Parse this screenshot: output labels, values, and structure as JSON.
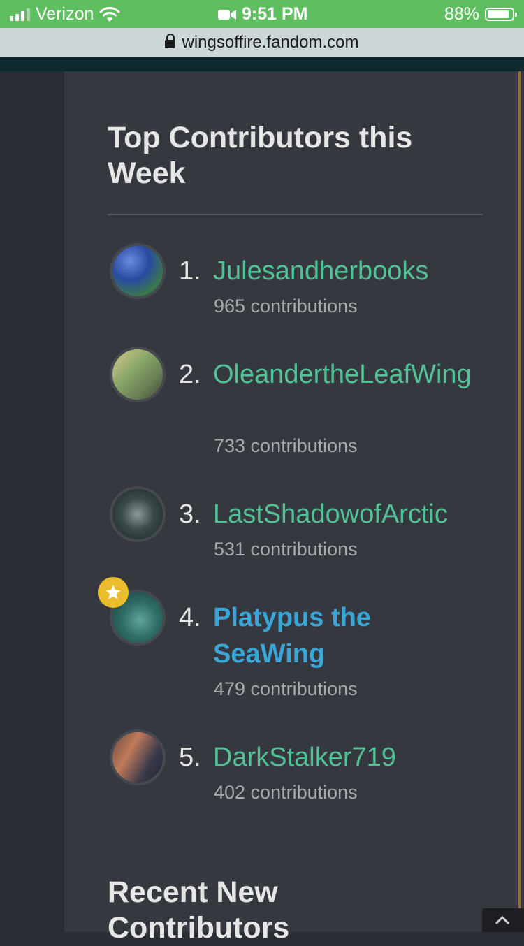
{
  "status_bar": {
    "carrier": "Verizon",
    "time": "9:51 PM",
    "battery": "88%",
    "battery_level": 0.88,
    "icons": [
      "signal-icon",
      "wifi-icon",
      "video-camera-icon",
      "battery-icon"
    ]
  },
  "url_bar": {
    "url": "wingsoffire.fandom.com",
    "icon": "lock-icon"
  },
  "section": {
    "title": "Top Contributors this Week"
  },
  "contributors": [
    {
      "rank": "1.",
      "name": "Julesandherbooks",
      "count": "965 contributions"
    },
    {
      "rank": "2.",
      "name": "OleandertheLeafWing",
      "count": "733 contributions"
    },
    {
      "rank": "3.",
      "name": "LastShadowofArctic",
      "count": "531 contributions"
    },
    {
      "rank": "4.",
      "name": "Platypus the SeaWing",
      "count": "479 contributions",
      "badge_icon": "star-icon"
    },
    {
      "rank": "5.",
      "name": "DarkStalker719",
      "count": "402 contributions"
    }
  ],
  "next_section": {
    "title": "Recent New Contributors"
  },
  "colors": {
    "status_bar": "#5fbe5f",
    "panel": "#35383e",
    "link": "#53c196",
    "highlight_link": "#3aa6d8",
    "badge": "#e9bd2b"
  }
}
